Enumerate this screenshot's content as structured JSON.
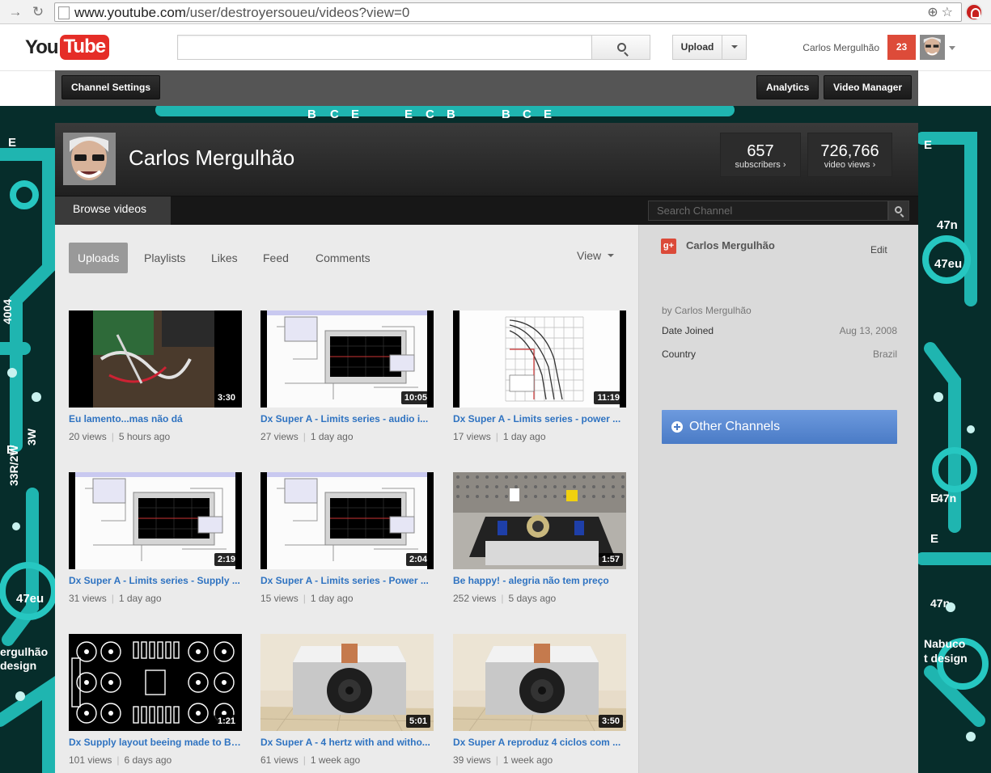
{
  "browser": {
    "url_host": "www.youtube.com",
    "url_path": "/user/destroyersoueu/videos?view=0"
  },
  "header": {
    "logo_you": "You",
    "logo_tube": "Tube",
    "search_value": "",
    "upload_label": "Upload",
    "user_name": "Carlos Mergulhão",
    "notifications": "23"
  },
  "toolbar": {
    "channel_settings": "Channel Settings",
    "analytics": "Analytics",
    "video_manager": "Video Manager"
  },
  "channel": {
    "name": "Carlos Mergulhão",
    "subscribers": {
      "value": "657",
      "label": "subscribers ›"
    },
    "views": {
      "value": "726,766",
      "label": "video views ›"
    },
    "browse_tab": "Browse videos",
    "search_placeholder": "Search Channel"
  },
  "tabs": [
    "Uploads",
    "Playlists",
    "Likes",
    "Feed",
    "Comments"
  ],
  "view_label": "View",
  "videos": [
    {
      "title": "Eu lamento...mas não dá",
      "views": "20 views",
      "age": "5 hours ago",
      "duration": "3:30",
      "thumb": "photo-circuit"
    },
    {
      "title": "Dx Super A - Limits series - audio i...",
      "views": "27 views",
      "age": "1 day ago",
      "duration": "10:05",
      "thumb": "simulator"
    },
    {
      "title": "Dx Super A - Limits series - power ...",
      "views": "17 views",
      "age": "1 day ago",
      "duration": "11:19",
      "thumb": "datasheet-graph"
    },
    {
      "title": "Dx Super A - Limits series - Supply ...",
      "views": "31 views",
      "age": "1 day ago",
      "duration": "2:19",
      "thumb": "simulator"
    },
    {
      "title": "Dx Super A - Limits series - Power ...",
      "views": "15 views",
      "age": "1 day ago",
      "duration": "2:04",
      "thumb": "simulator"
    },
    {
      "title": "Be happy! - alegria não tem preço",
      "views": "252 views",
      "age": "5 days ago",
      "duration": "1:57",
      "thumb": "amplifier"
    },
    {
      "title": "Dx Supply layout beeing made to Br...",
      "views": "101 views",
      "age": "6 days ago",
      "duration": "1:21",
      "thumb": "pcb-layout"
    },
    {
      "title": "Dx Super A - 4 hertz with and witho...",
      "views": "61 views",
      "age": "1 week ago",
      "duration": "5:01",
      "thumb": "speaker"
    },
    {
      "title": "Dx Super A reproduz 4 ciclos com ...",
      "views": "39 views",
      "age": "1 week ago",
      "duration": "3:50",
      "thumb": "speaker"
    }
  ],
  "sidebar": {
    "name": "Carlos Mergulhão",
    "edit": "Edit",
    "by_line": "by Carlos Mergulhão",
    "date_joined_label": "Date Joined",
    "date_joined": "Aug 13, 2008",
    "country_label": "Country",
    "country": "Brazil",
    "other_channels": "Other Channels"
  },
  "colors": {
    "youtube_red": "#e52d27",
    "link_blue": "#2f73c1",
    "notification_red": "#dd4b39",
    "other_channels_blue": "#5586d2"
  }
}
